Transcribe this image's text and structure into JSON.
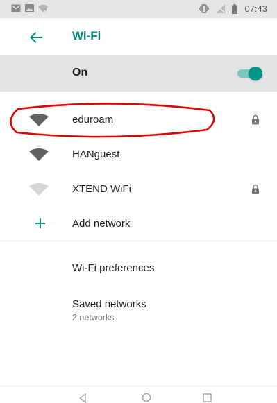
{
  "status_bar": {
    "time": "07:43",
    "left_icons": [
      "gmail-icon",
      "image-icon",
      "wifi-question-icon"
    ],
    "right_icons": [
      "vibrate-icon",
      "no-signal-icon",
      "battery-icon"
    ]
  },
  "app_bar": {
    "title": "Wi-Fi",
    "back_icon": "arrow-left-icon"
  },
  "master_switch": {
    "label": "On",
    "state": "on"
  },
  "networks": [
    {
      "ssid": "eduroam",
      "signal": "full",
      "secured": true,
      "highlighted": true
    },
    {
      "ssid": "HANguest",
      "signal": "full",
      "secured": false,
      "highlighted": false
    },
    {
      "ssid": "XTEND WiFi",
      "signal": "weak",
      "secured": true,
      "highlighted": false
    }
  ],
  "add_network": {
    "label": "Add network",
    "icon": "plus-icon"
  },
  "preferences": [
    {
      "title": "Wi-Fi preferences"
    },
    {
      "title": "Saved networks",
      "subtitle": "2 networks"
    }
  ],
  "nav_bar": {
    "buttons": [
      "back-triangle-icon",
      "home-circle-icon",
      "recents-square-icon"
    ]
  },
  "colors": {
    "accent": "#009688",
    "title_teal": "#00897b",
    "toggle_track": "#7fc7bd",
    "master_row_bg": "#e3e3e3",
    "status_bar_bg": "#e6e6e6",
    "annotation_red": "#e00000",
    "signal_full": "#616161",
    "signal_weak": "#d6d6d6"
  }
}
